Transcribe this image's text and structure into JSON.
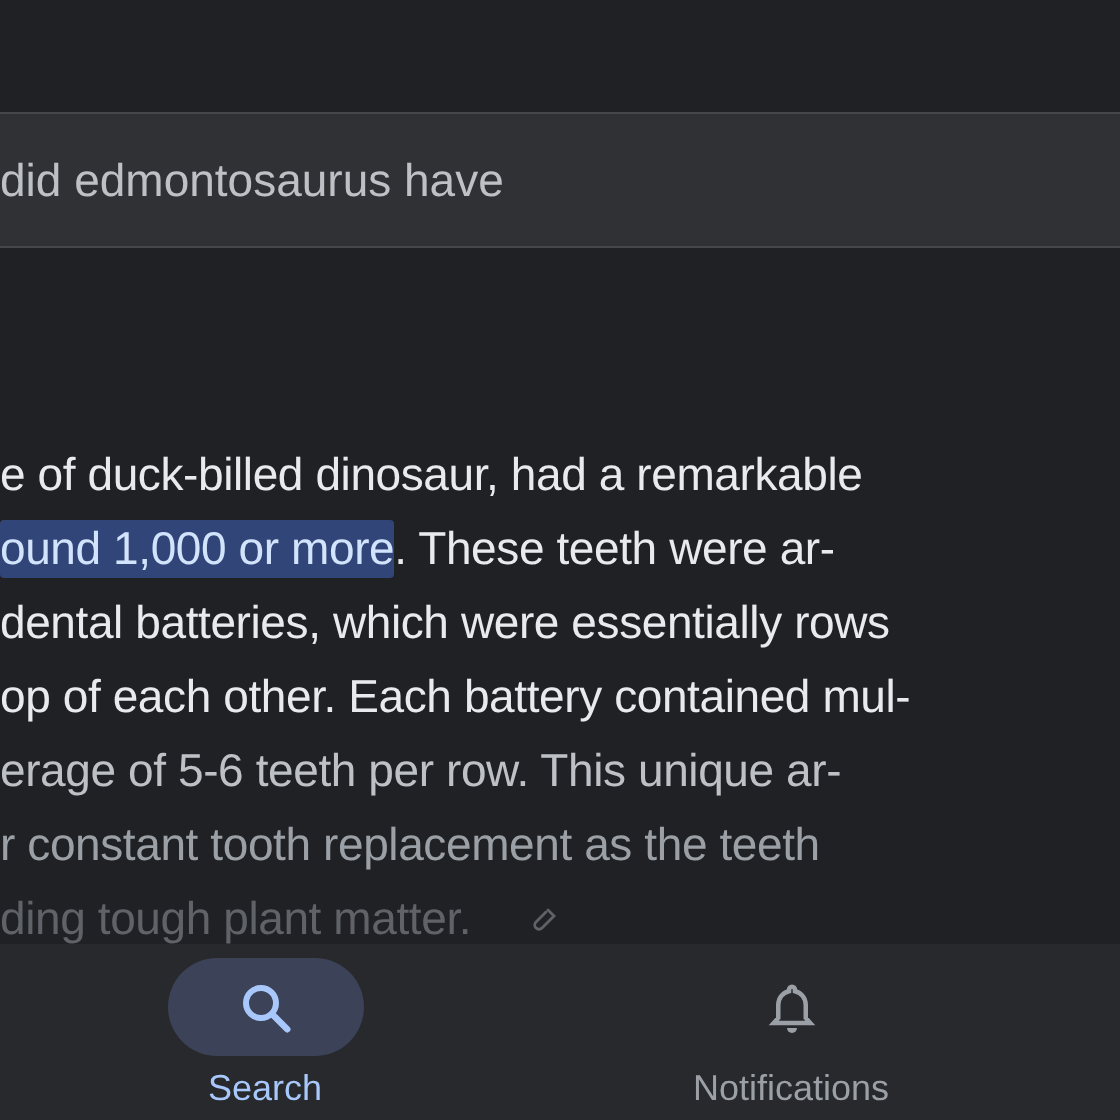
{
  "search_field": {
    "value": "did edmontosaurus have"
  },
  "answer": {
    "lines": [
      [
        {
          "text": "e of duck-billed dinosaur, had a remarkable",
          "highlighted": false
        }
      ],
      [
        {
          "text": "ound 1,000 or more",
          "highlighted": true
        },
        {
          "text": ". These teeth were ar-",
          "highlighted": false
        }
      ],
      [
        {
          "text": "dental batteries, which were essentially rows",
          "highlighted": false
        }
      ],
      [
        {
          "text": "op of each other. Each battery contained mul-",
          "highlighted": false
        }
      ],
      [
        {
          "text": "erage of 5-6 teeth per row. This unique ar-",
          "highlighted": false
        }
      ],
      [
        {
          "text": "r constant tooth replacement as the teeth",
          "highlighted": false
        }
      ],
      [
        {
          "text": "ding tough plant matter.",
          "highlighted": false
        }
      ]
    ]
  },
  "nav": [
    {
      "label": "Search",
      "kind": "search",
      "selected": true
    },
    {
      "label": "Notifications",
      "kind": "bell",
      "selected": false
    }
  ]
}
